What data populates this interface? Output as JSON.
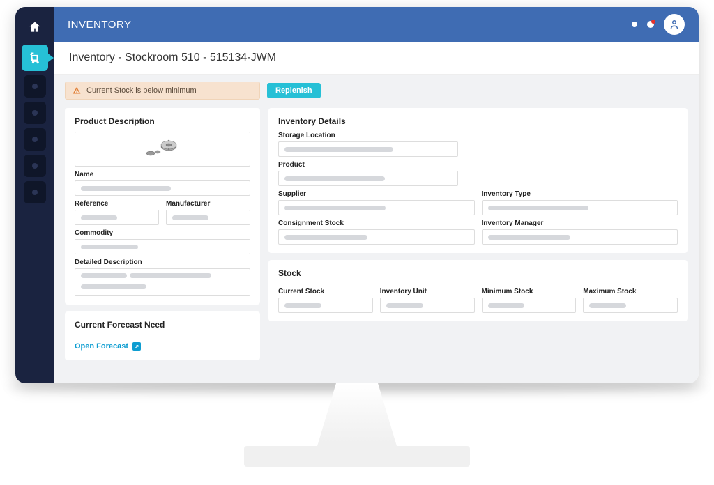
{
  "header": {
    "title": "INVENTORY"
  },
  "breadcrumb": "Inventory - Stockroom 510 - 515134-JWM",
  "alert": {
    "text": "Current Stock is below minimum"
  },
  "actions": {
    "replenish": "Replenish"
  },
  "productDescription": {
    "title": "Product Description",
    "fields": {
      "name": "Name",
      "reference": "Reference",
      "manufacturer": "Manufacturer",
      "commodity": "Commodity",
      "detailedDescription": "Detailed Description"
    }
  },
  "forecast": {
    "title": "Current Forecast Need",
    "link": "Open Forecast"
  },
  "inventoryDetails": {
    "title": "Inventory Details",
    "fields": {
      "storageLocation": "Storage Location",
      "product": "Product",
      "supplier": "Supplier",
      "inventoryType": "Inventory Type",
      "consignmentStock": "Consignment Stock",
      "inventoryManager": "Inventory Manager"
    }
  },
  "stock": {
    "title": "Stock",
    "fields": {
      "currentStock": "Current Stock",
      "inventoryUnit": "Inventory Unit",
      "minimumStock": "Minimum Stock",
      "maximumStock": "Maximum Stock"
    }
  }
}
